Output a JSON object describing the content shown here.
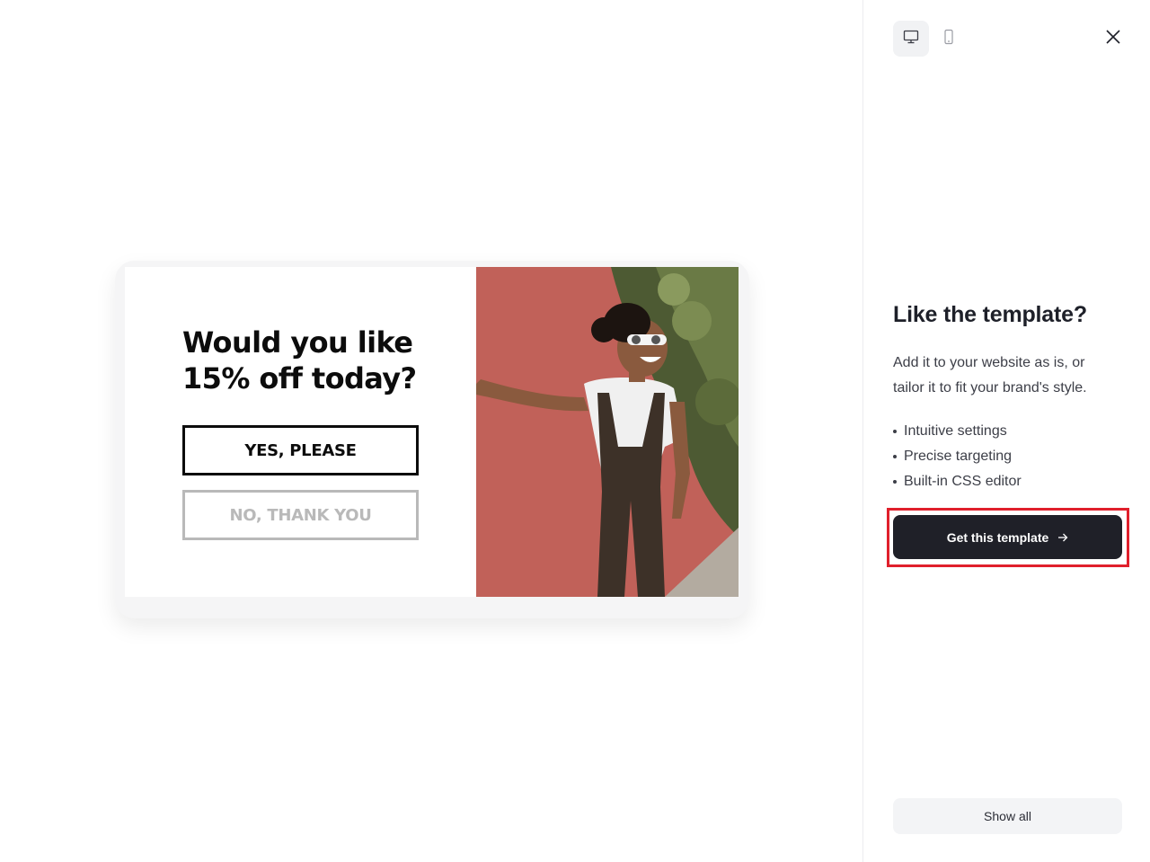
{
  "popup": {
    "headline_line1": "Would you like",
    "headline_line2": "15% off today?",
    "yes_label": "YES, PLEASE",
    "no_label": "NO, THANK YOU"
  },
  "panel": {
    "title": "Like the template?",
    "description": "Add it to your website as is, or tailor it to fit your brand's style.",
    "features": [
      "Intuitive settings",
      "Precise targeting",
      "Built-in CSS editor"
    ],
    "cta_label": "Get this template",
    "show_all_label": "Show all",
    "icons": {
      "desktop": "desktop-icon",
      "mobile": "mobile-icon",
      "close": "close-icon",
      "arrow": "arrow-right-icon"
    }
  },
  "colors": {
    "cta_background": "#1f2028",
    "highlight_outline": "#e0202c",
    "photo_wall": "#c4645d"
  }
}
